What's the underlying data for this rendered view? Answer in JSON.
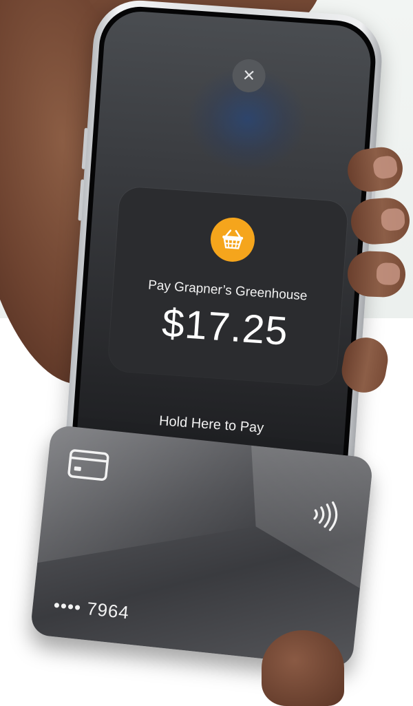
{
  "payment_sheet": {
    "close_icon_glyph": "×",
    "merchant_label": "Pay Grapner’s Greenhouse",
    "amount": "$17.25",
    "instruction": "Hold Here to Pay",
    "merchant_icon": "basket-icon",
    "merchant_icon_color": "#F5A51C"
  },
  "card": {
    "number_masked": "•••• 7964",
    "icons": [
      "credit-card-icon",
      "contactless-icon"
    ]
  }
}
